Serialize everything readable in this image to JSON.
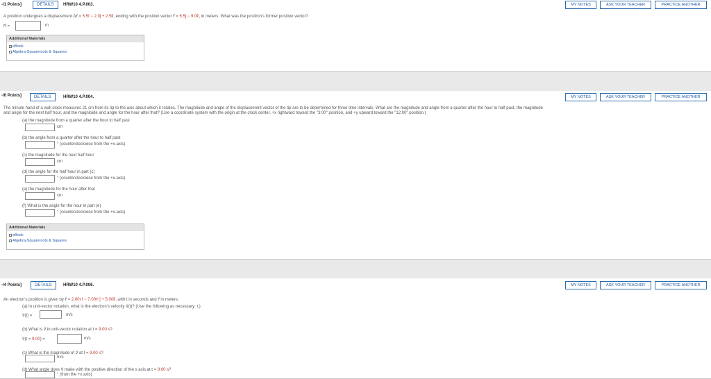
{
  "q1": {
    "points": "-/1 Points]",
    "details": "DETAILS",
    "id": "HRW10 4.P.003.",
    "my_notes": "MY NOTES",
    "ask": "ASK YOUR TEACHER",
    "practice": "PRACTICE ANOTHER",
    "question_a": "A positron undergoes a displacement Δr⃗ = ",
    "question_b": "5.5î − 2.0ĵ + 2.5k̂",
    "question_c": ", ending with the position vector r⃗ = ",
    "question_d": "5.5ĵ − 9.0k̂",
    "question_e": ", in meters. What was the positron's former position vector?",
    "answer_label": "r⃗i =",
    "unit": "m",
    "additional_title": "Additional Materials",
    "ebook": "eBook",
    "algebra": "Algebra-Squareroots & Squares"
  },
  "q2": {
    "points": "-/6 Points]",
    "details": "DETAILS",
    "id": "HRW10 4.P.004.",
    "my_notes": "MY NOTES",
    "ask": "ASK YOUR TEACHER",
    "practice": "PRACTICE ANOTHER",
    "para1": "The minute hand of a wall clock measures 21 cm from its tip to the axis about which it rotates. The magnitude and angle of the displacement vector of the tip are to be determined for three time intervals. What are the magnitude and angle from a quarter after the hour to half past, the magnitude",
    "para2": "and angle for the next half hour, and the magnitude and angle for the hour after that? (Use a coordinate system with the origin at the clock center, +x rightward toward the \"3:00\" position, and +y upward toward the \"12:00\" position.)",
    "a_label": "(a) the magnitude from a quarter after the hour to half past",
    "a_unit": "cm",
    "b_label": "(b) the angle from a quarter after the hour to half past",
    "b_unit": "° (counterclockwise from the +x-axis)",
    "c_label": "(c) the magnitude for the next half hour",
    "c_unit": "cm",
    "d_label": "(d) the angle for the half hour in part (c)",
    "d_unit": "° (counterclockwise from the +x-axis)",
    "e_label": "(e) the magnitude for the hour after that",
    "e_unit": "cm",
    "f_label": "(f) What is the angle for the hour in part (e)",
    "f_unit": "° (counterclockwise from the +x-axis)",
    "additional_title": "Additional Materials",
    "ebook": "eBook",
    "algebra": "Algebra-Squareroots & Squares"
  },
  "q3": {
    "points": "-/4 Points]",
    "details": "DETAILS",
    "id": "HRW10 4.P.006.",
    "my_notes": "MY NOTES",
    "ask": "ASK YOUR TEACHER",
    "practice": "PRACTICE ANOTHER",
    "intro_a": "An electron's position is given by r⃗ = ",
    "intro_b": "2.00t î − 7.00t² ĵ + 5.00k̂",
    "intro_c": ", with t in seconds and r⃗ in meters.",
    "a_label": "(a) In unit-vector notation, what is the electron's velocity v⃗(t)? (Use the following as necessary: t.)",
    "a_prefix": "v⃗(t) =",
    "a_unit": "m/s",
    "b_label_a": "(b) What is v⃗ in unit-vector notation at t = ",
    "b_label_b": "9.00 s",
    "b_label_c": "?",
    "b_prefix_a": "v⃗(t = ",
    "b_prefix_b": "9.00",
    "b_prefix_c": ") =",
    "b_unit": "m/s",
    "c_label_a": "(c) What is the magnitude of v⃗ at t = ",
    "c_label_b": "9.00 s",
    "c_label_c": "?",
    "c_unit": "m/s",
    "d_label_a": "(d) What angle does v⃗ make with the positive direction of the x axis at t = ",
    "d_label_b": "9.00 s",
    "d_label_c": "?",
    "d_unit": "° (from the +x axis)"
  }
}
